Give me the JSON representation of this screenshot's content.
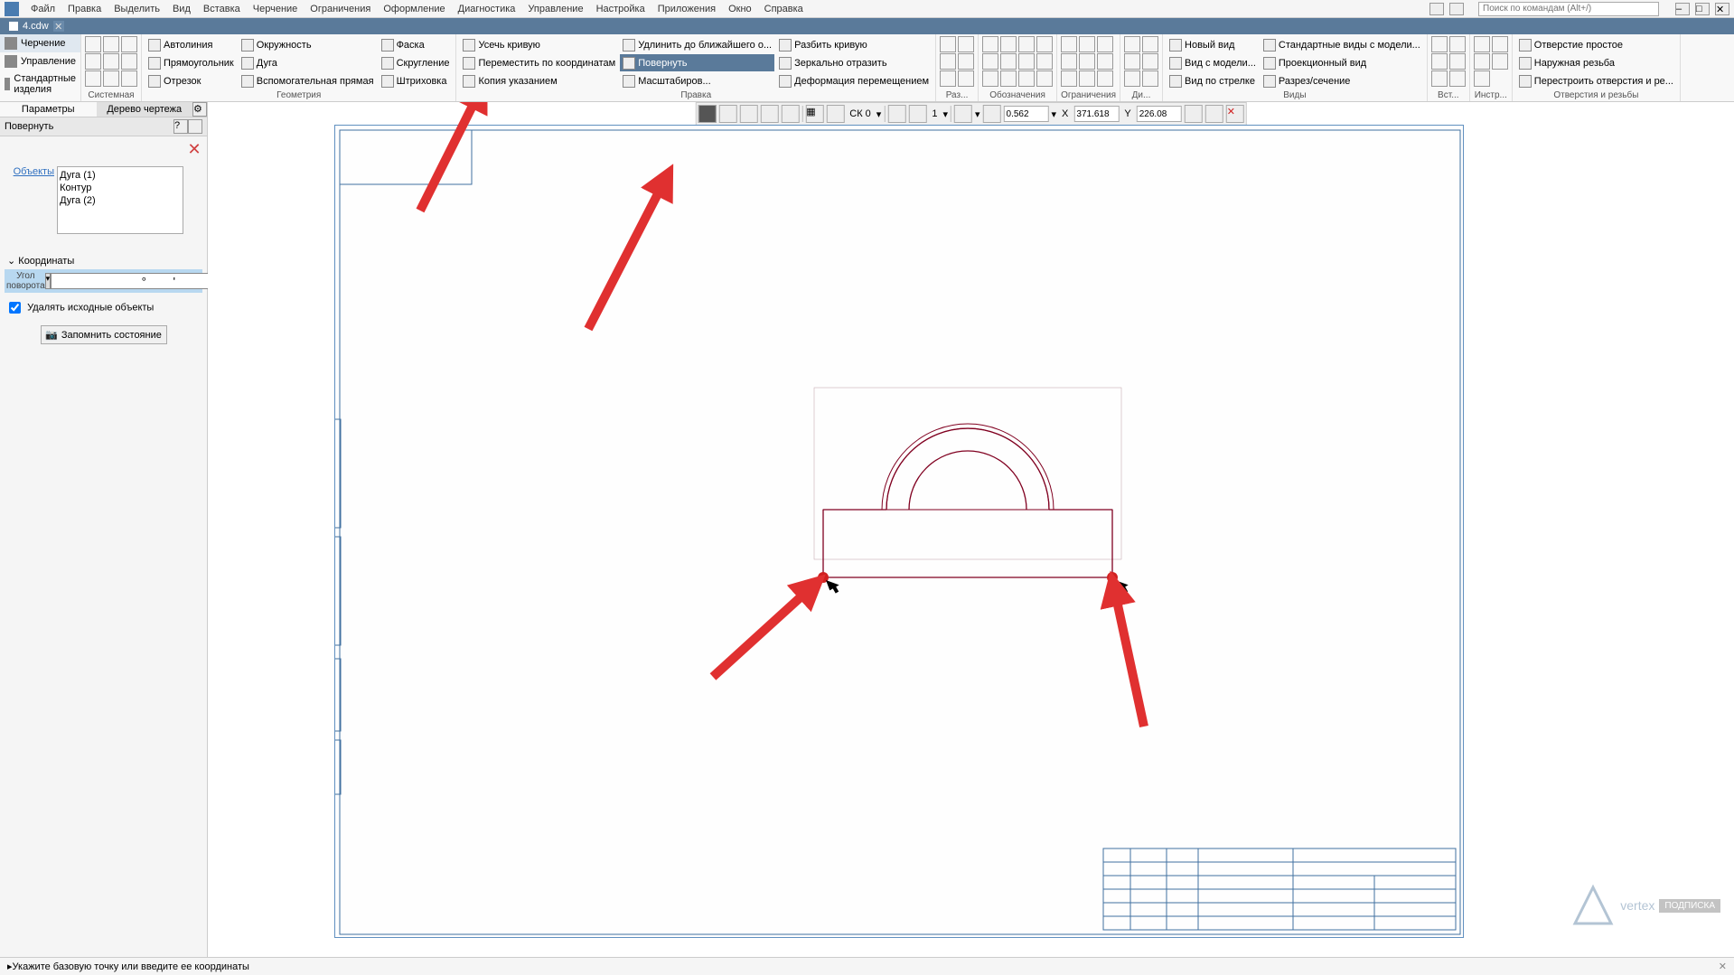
{
  "menu": {
    "file": "Файл",
    "edit": "Правка",
    "select": "Выделить",
    "view": "Вид",
    "insert": "Вставка",
    "drawing": "Черчение",
    "constraints": "Ограничения",
    "design": "Оформление",
    "diagnostics": "Диагностика",
    "manage": "Управление",
    "settings": "Настройка",
    "apps": "Приложения",
    "window": "Окно",
    "help": "Справка"
  },
  "search_placeholder": "Поиск по командам (Alt+/)",
  "doc_tab": "4.cdw",
  "side_tabs": {
    "drawing": "Черчение",
    "manage": "Управление",
    "standard": "Стандартные изделия"
  },
  "ribbon": {
    "system_label": "Системная",
    "geometry_label": "Геометрия",
    "edit_label": "Правка",
    "dims_label": "Раз...",
    "annot_label": "Обозначения",
    "constr_label": "Ограничения",
    "diag_label": "Ди...",
    "views_label": "Виды",
    "insert_label": "Вст...",
    "tools_label": "Инстр...",
    "holes_label": "Отверстия и резьбы",
    "autoline": "Автолиния",
    "rectangle": "Прямоугольник",
    "segment": "Отрезок",
    "circle": "Окружность",
    "arc": "Дуга",
    "aux_line": "Вспомогательная прямая",
    "chamfer": "Фаска",
    "fillet": "Скругление",
    "hatch": "Штриховка",
    "trim": "Усечь кривую",
    "move_coord": "Переместить по координатам",
    "copy_pick": "Копия указанием",
    "extend": "Удлинить до ближайшего о...",
    "rotate": "Повернуть",
    "scale": "Масштабиров...",
    "split": "Разбить кривую",
    "mirror": "Зеркально отразить",
    "deform": "Деформация перемещением",
    "new_view": "Новый вид",
    "model_view": "Вид с модели...",
    "arrow_view": "Вид по стрелке",
    "std_views": "Стандартные виды с модели...",
    "proj_view": "Проекционный вид",
    "section": "Разрез/сечение",
    "hole_simple": "Отверстие простое",
    "thread_ext": "Наружная резьба",
    "rebuild": "Перестроить отверстия и ре..."
  },
  "panel": {
    "params_title": "Параметры",
    "tree_title": "Дерево чертежа",
    "rotate_label": "Повернуть",
    "objects_label": "Объекты",
    "obj1": "Дуга (1)",
    "obj2": "Контур",
    "obj3": "Дуга (2)",
    "coord_header": "Координаты",
    "angle_label": "Угол поворота",
    "angle_deg": "°",
    "angle_min": "'",
    "delete_src": "Удалять исходные объекты",
    "save_state": "Запомнить состояние"
  },
  "toolbar": {
    "cs": "СК 0",
    "num": "1",
    "zoom": "0.562",
    "x_label": "X",
    "x_val": "371.618",
    "y_label": "Y",
    "y_val": "226.08"
  },
  "status": {
    "msg": "Укажите базовую точку или введите ее координаты"
  },
  "watermark": {
    "text": "vertex",
    "badge": "ПОДПИСКА"
  }
}
